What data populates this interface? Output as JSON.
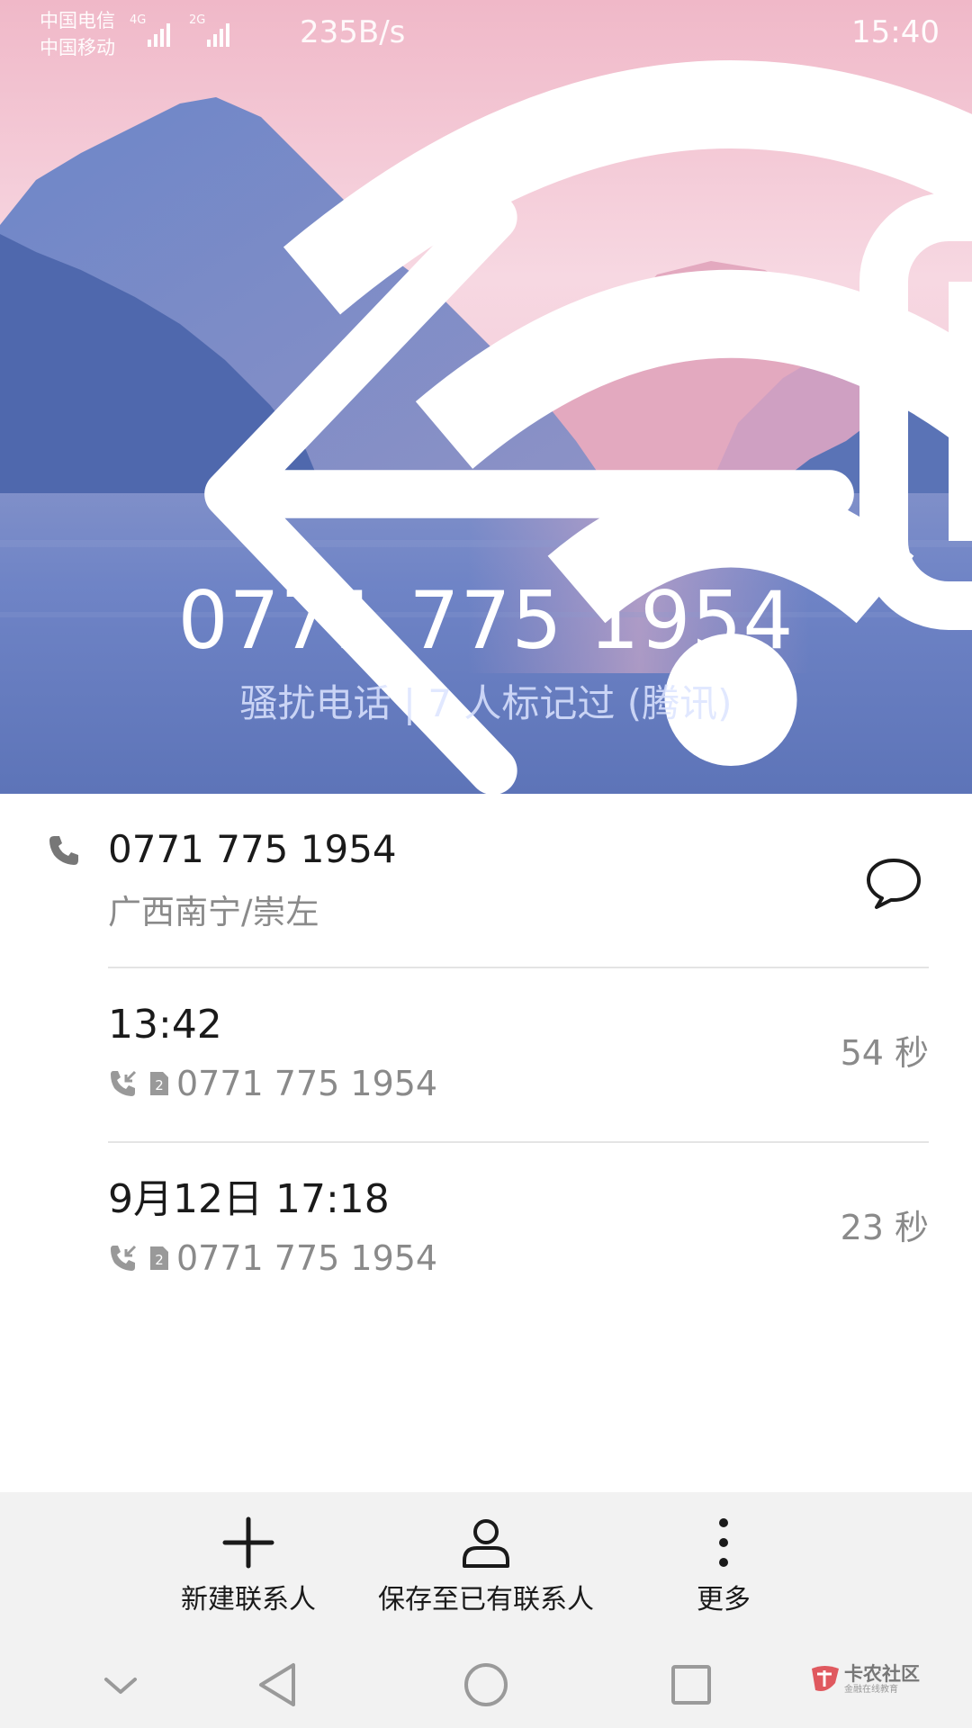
{
  "status_bar": {
    "carrier_1": "中国电信",
    "carrier_2": "中国移动",
    "network_1": "4G",
    "network_2": "2G",
    "net_speed": "235B/s",
    "time": "15:40"
  },
  "header": {
    "number": "0771 775 1954",
    "tag": "骚扰电话 | 7 人标记过 (腾讯)"
  },
  "contact": {
    "number": "0771 775 1954",
    "location": "广西南宁/崇左"
  },
  "calls": [
    {
      "time": "13:42",
      "sim": "2",
      "number": "0771 775 1954",
      "duration": "54 秒"
    },
    {
      "time": "9月12日 17:18",
      "sim": "2",
      "number": "0771 775 1954",
      "duration": "23 秒"
    }
  ],
  "actions": {
    "new_contact": "新建联系人",
    "save_existing": "保存至已有联系人",
    "more": "更多"
  },
  "watermark": {
    "title": "卡农社区",
    "subtitle": "金融在线教育"
  },
  "colors": {
    "sky_pink": "#f6d6e1",
    "mountain_blue": "#5c74b4",
    "water_blue": "#6a80c4",
    "text_dark": "#1a1a1a",
    "text_gray": "#8a8a8a",
    "bar_gray": "#f2f2f2"
  },
  "icons": {
    "back": "arrow-left-icon",
    "phone": "phone-icon",
    "message": "chat-bubble-icon",
    "incoming_call": "incoming-call-icon",
    "sim": "sim-card-icon",
    "add": "plus-icon",
    "person": "person-icon",
    "more": "more-vertical-icon"
  }
}
